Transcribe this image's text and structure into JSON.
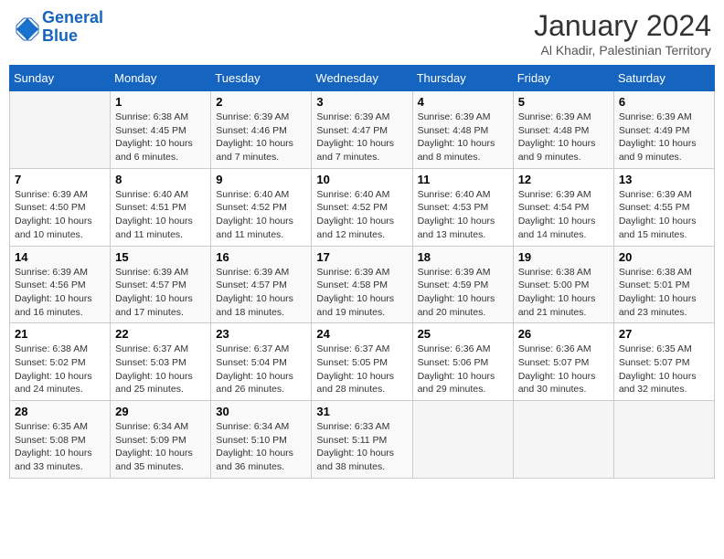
{
  "header": {
    "logo_line1": "General",
    "logo_line2": "Blue",
    "title": "January 2024",
    "subtitle": "Al Khadir, Palestinian Territory"
  },
  "columns": [
    "Sunday",
    "Monday",
    "Tuesday",
    "Wednesday",
    "Thursday",
    "Friday",
    "Saturday"
  ],
  "weeks": [
    [
      {
        "day": "",
        "info": ""
      },
      {
        "day": "1",
        "info": "Sunrise: 6:38 AM\nSunset: 4:45 PM\nDaylight: 10 hours\nand 6 minutes."
      },
      {
        "day": "2",
        "info": "Sunrise: 6:39 AM\nSunset: 4:46 PM\nDaylight: 10 hours\nand 7 minutes."
      },
      {
        "day": "3",
        "info": "Sunrise: 6:39 AM\nSunset: 4:47 PM\nDaylight: 10 hours\nand 7 minutes."
      },
      {
        "day": "4",
        "info": "Sunrise: 6:39 AM\nSunset: 4:48 PM\nDaylight: 10 hours\nand 8 minutes."
      },
      {
        "day": "5",
        "info": "Sunrise: 6:39 AM\nSunset: 4:48 PM\nDaylight: 10 hours\nand 9 minutes."
      },
      {
        "day": "6",
        "info": "Sunrise: 6:39 AM\nSunset: 4:49 PM\nDaylight: 10 hours\nand 9 minutes."
      }
    ],
    [
      {
        "day": "7",
        "info": "Sunrise: 6:39 AM\nSunset: 4:50 PM\nDaylight: 10 hours\nand 10 minutes."
      },
      {
        "day": "8",
        "info": "Sunrise: 6:40 AM\nSunset: 4:51 PM\nDaylight: 10 hours\nand 11 minutes."
      },
      {
        "day": "9",
        "info": "Sunrise: 6:40 AM\nSunset: 4:52 PM\nDaylight: 10 hours\nand 11 minutes."
      },
      {
        "day": "10",
        "info": "Sunrise: 6:40 AM\nSunset: 4:52 PM\nDaylight: 10 hours\nand 12 minutes."
      },
      {
        "day": "11",
        "info": "Sunrise: 6:40 AM\nSunset: 4:53 PM\nDaylight: 10 hours\nand 13 minutes."
      },
      {
        "day": "12",
        "info": "Sunrise: 6:39 AM\nSunset: 4:54 PM\nDaylight: 10 hours\nand 14 minutes."
      },
      {
        "day": "13",
        "info": "Sunrise: 6:39 AM\nSunset: 4:55 PM\nDaylight: 10 hours\nand 15 minutes."
      }
    ],
    [
      {
        "day": "14",
        "info": "Sunrise: 6:39 AM\nSunset: 4:56 PM\nDaylight: 10 hours\nand 16 minutes."
      },
      {
        "day": "15",
        "info": "Sunrise: 6:39 AM\nSunset: 4:57 PM\nDaylight: 10 hours\nand 17 minutes."
      },
      {
        "day": "16",
        "info": "Sunrise: 6:39 AM\nSunset: 4:57 PM\nDaylight: 10 hours\nand 18 minutes."
      },
      {
        "day": "17",
        "info": "Sunrise: 6:39 AM\nSunset: 4:58 PM\nDaylight: 10 hours\nand 19 minutes."
      },
      {
        "day": "18",
        "info": "Sunrise: 6:39 AM\nSunset: 4:59 PM\nDaylight: 10 hours\nand 20 minutes."
      },
      {
        "day": "19",
        "info": "Sunrise: 6:38 AM\nSunset: 5:00 PM\nDaylight: 10 hours\nand 21 minutes."
      },
      {
        "day": "20",
        "info": "Sunrise: 6:38 AM\nSunset: 5:01 PM\nDaylight: 10 hours\nand 23 minutes."
      }
    ],
    [
      {
        "day": "21",
        "info": "Sunrise: 6:38 AM\nSunset: 5:02 PM\nDaylight: 10 hours\nand 24 minutes."
      },
      {
        "day": "22",
        "info": "Sunrise: 6:37 AM\nSunset: 5:03 PM\nDaylight: 10 hours\nand 25 minutes."
      },
      {
        "day": "23",
        "info": "Sunrise: 6:37 AM\nSunset: 5:04 PM\nDaylight: 10 hours\nand 26 minutes."
      },
      {
        "day": "24",
        "info": "Sunrise: 6:37 AM\nSunset: 5:05 PM\nDaylight: 10 hours\nand 28 minutes."
      },
      {
        "day": "25",
        "info": "Sunrise: 6:36 AM\nSunset: 5:06 PM\nDaylight: 10 hours\nand 29 minutes."
      },
      {
        "day": "26",
        "info": "Sunrise: 6:36 AM\nSunset: 5:07 PM\nDaylight: 10 hours\nand 30 minutes."
      },
      {
        "day": "27",
        "info": "Sunrise: 6:35 AM\nSunset: 5:07 PM\nDaylight: 10 hours\nand 32 minutes."
      }
    ],
    [
      {
        "day": "28",
        "info": "Sunrise: 6:35 AM\nSunset: 5:08 PM\nDaylight: 10 hours\nand 33 minutes."
      },
      {
        "day": "29",
        "info": "Sunrise: 6:34 AM\nSunset: 5:09 PM\nDaylight: 10 hours\nand 35 minutes."
      },
      {
        "day": "30",
        "info": "Sunrise: 6:34 AM\nSunset: 5:10 PM\nDaylight: 10 hours\nand 36 minutes."
      },
      {
        "day": "31",
        "info": "Sunrise: 6:33 AM\nSunset: 5:11 PM\nDaylight: 10 hours\nand 38 minutes."
      },
      {
        "day": "",
        "info": ""
      },
      {
        "day": "",
        "info": ""
      },
      {
        "day": "",
        "info": ""
      }
    ]
  ]
}
